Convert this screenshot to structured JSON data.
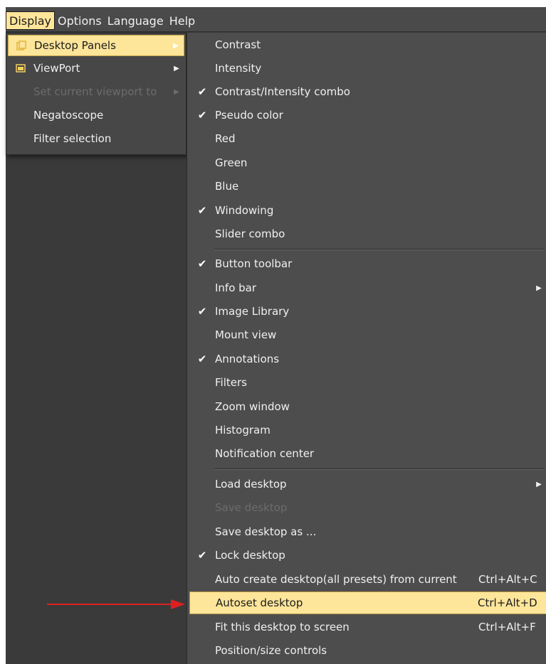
{
  "menubar": {
    "items": [
      "Display",
      "Options",
      "Language",
      "Help"
    ]
  },
  "display_menu": {
    "items": [
      {
        "label": "Desktop Panels",
        "icon": "panels-icon",
        "submenu": true
      },
      {
        "label": "ViewPort",
        "icon": "viewport-icon",
        "submenu": true
      },
      {
        "label": "Set current viewport to",
        "submenu": true,
        "disabled": true
      },
      {
        "label": "Negatoscope"
      },
      {
        "label": "Filter selection"
      }
    ]
  },
  "panels_menu": {
    "items": [
      {
        "label": "Contrast",
        "checked": false
      },
      {
        "label": "Intensity",
        "checked": false
      },
      {
        "label": "Contrast/Intensity combo",
        "checked": true
      },
      {
        "label": "Pseudo color",
        "checked": true
      },
      {
        "label": "Red",
        "checked": false
      },
      {
        "label": "Green",
        "checked": false
      },
      {
        "label": "Blue",
        "checked": false
      },
      {
        "label": "Windowing",
        "checked": true
      },
      {
        "label": "Slider combo",
        "checked": false
      },
      {
        "label": "Button toolbar",
        "checked": true
      },
      {
        "label": "Info bar",
        "checked": false,
        "submenu": true
      },
      {
        "label": "Image Library",
        "checked": true
      },
      {
        "label": "Mount view",
        "checked": false
      },
      {
        "label": "Annotations",
        "checked": true
      },
      {
        "label": "Filters",
        "checked": false
      },
      {
        "label": "Zoom window",
        "checked": false
      },
      {
        "label": "Histogram",
        "checked": false
      },
      {
        "label": "Notification center",
        "checked": false
      },
      {
        "label": "Load desktop",
        "checked": false,
        "submenu": true
      },
      {
        "label": "Save desktop",
        "disabled": true
      },
      {
        "label": "Save desktop as ...",
        "checked": false
      },
      {
        "label": "Lock desktop",
        "checked": true
      },
      {
        "label": "Auto create desktop(all presets) from current",
        "shortcut": "Ctrl+Alt+C"
      },
      {
        "label": "Autoset desktop",
        "shortcut": "Ctrl+Alt+D",
        "highlighted": true
      },
      {
        "label": "Fit this desktop to screen",
        "shortcut": "Ctrl+Alt+F"
      },
      {
        "label": "Position/size controls"
      }
    ]
  },
  "colors": {
    "highlight": "#fde59a",
    "menu_bg": "#4d4d4d",
    "annotation_arrow": "#e02020"
  }
}
